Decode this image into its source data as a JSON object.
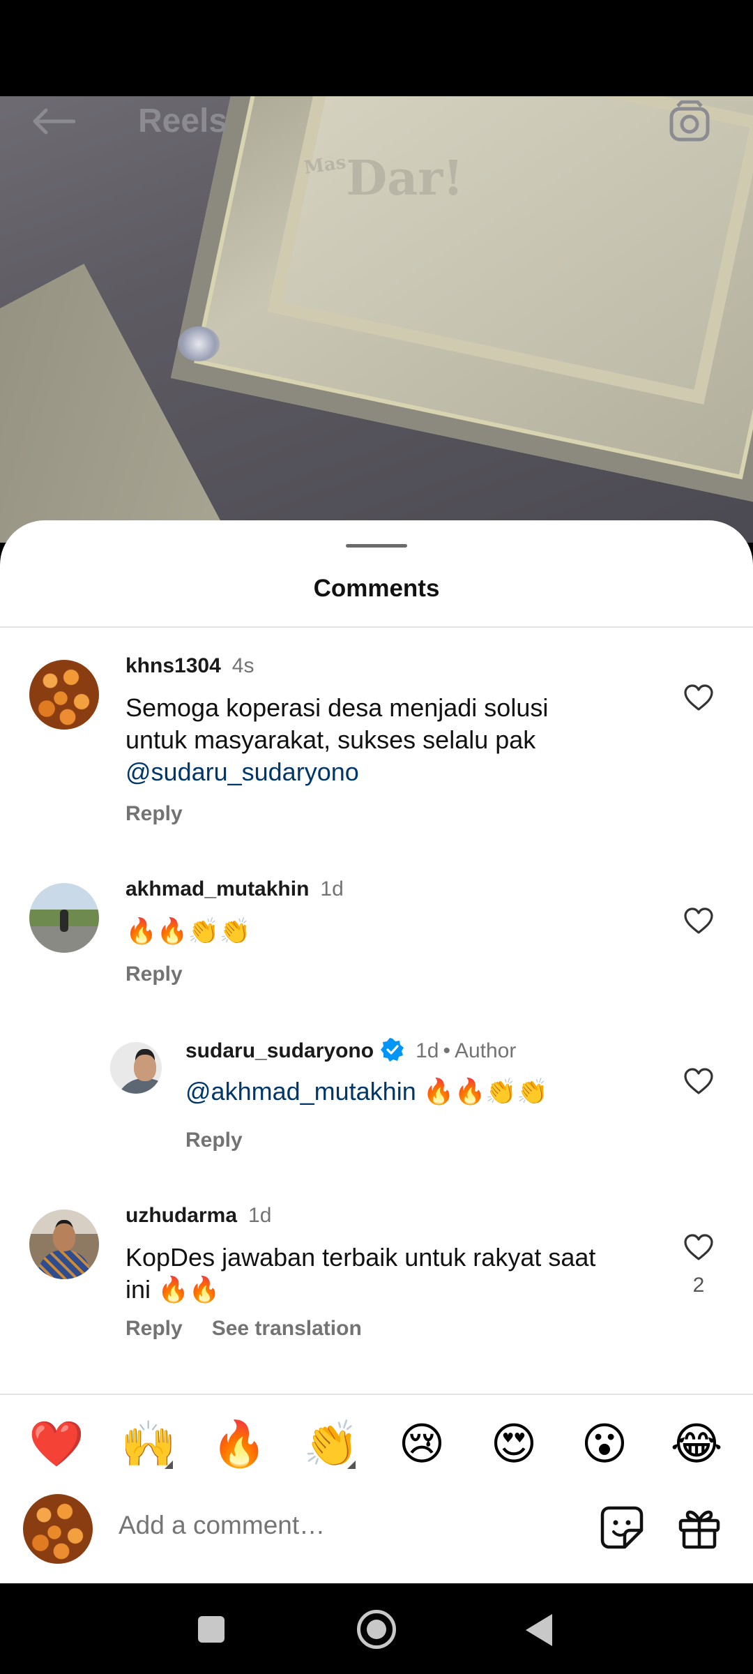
{
  "header": {
    "title": "Reels",
    "watermark_small": "Mas",
    "watermark_big": "Dar!"
  },
  "sheet": {
    "title": "Comments"
  },
  "comments": [
    {
      "username": "khns1304",
      "time": "4s",
      "text_lines": [
        "Semoga koperasi desa menjadi solusi",
        "untuk masyarakat, sukses selalu pak"
      ],
      "mention": "@sudaru_sudaryono",
      "reply": "Reply",
      "likes": ""
    },
    {
      "username": "akhmad_mutakhin",
      "time": "1d",
      "emoji_text": "🔥🔥👏👏",
      "reply": "Reply",
      "likes": ""
    },
    {
      "username": "sudaru_sudaryono",
      "time": "1d",
      "separator": "•",
      "badge": "Author",
      "mention": "@akhmad_mutakhin",
      "emoji_text": "🔥🔥👏👏",
      "reply": "Reply",
      "likes": ""
    },
    {
      "username": "uzhudarma",
      "time": "1d",
      "text_lines": [
        "KopDes jawaban terbaik untuk rakyat saat",
        "ini 🔥🔥"
      ],
      "reply": "Reply",
      "translate": "See translation",
      "likes": "2"
    }
  ],
  "emoji_bar": [
    "❤️",
    "🙌",
    "🔥",
    "👏",
    "😢",
    "😍",
    "😮",
    "😂"
  ],
  "composer": {
    "placeholder": "Add a comment…"
  },
  "colors": {
    "mention": "#00376b",
    "verified": "#0095f6",
    "secondary_text": "#737373"
  }
}
